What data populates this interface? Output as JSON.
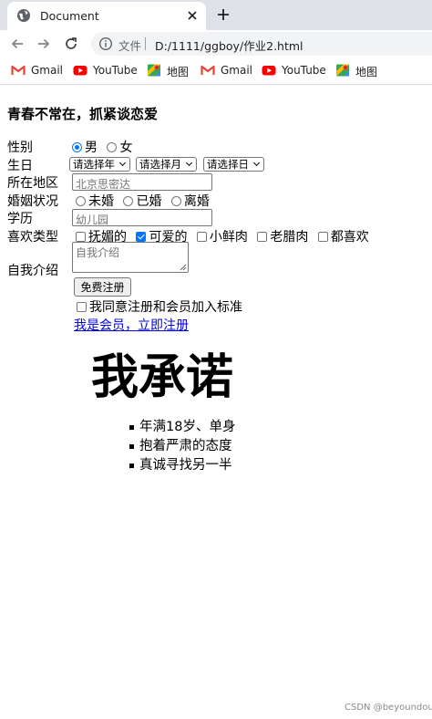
{
  "browser": {
    "tab_title": "Document",
    "address_scheme": "文件",
    "address_url": "D:/1111/ggboy/作业2.html"
  },
  "bookmarks": [
    {
      "label": "Gmail",
      "icon": "gmail-icon"
    },
    {
      "label": "YouTube",
      "icon": "youtube-icon"
    },
    {
      "label": "地图",
      "icon": "maps-icon"
    },
    {
      "label": "Gmail",
      "icon": "gmail-icon"
    },
    {
      "label": "YouTube",
      "icon": "youtube-icon"
    },
    {
      "label": "地图",
      "icon": "maps-icon"
    }
  ],
  "form": {
    "heading": "青春不常在，抓紧谈恋爱",
    "gender": {
      "label": "性别",
      "options": [
        "男",
        "女"
      ],
      "selected": "男"
    },
    "birthday": {
      "label": "生日",
      "year": "请选择年",
      "month": "请选择月",
      "day": "请选择日"
    },
    "region": {
      "label": "所在地区",
      "placeholder": "北京思密达"
    },
    "marital": {
      "label": "婚姻状况",
      "options": [
        "未婚",
        "已婚",
        "离婚"
      ]
    },
    "education": {
      "label": "学历",
      "placeholder": "幼儿园"
    },
    "likes": {
      "label": "喜欢类型",
      "options": [
        "抚媚的",
        "可爱的",
        "小鲜肉",
        "老腊肉",
        "都喜欢"
      ],
      "checked": [
        "可爱的"
      ]
    },
    "intro": {
      "label": "自我介绍",
      "placeholder": "自我介绍"
    },
    "submit_label": "免费注册",
    "agree_label": "我同意注册和会员加入标准",
    "member_link": "我是会员，立即注册"
  },
  "promise": {
    "title": "我承诺",
    "items": [
      "年满18岁、单身",
      "抱着严肃的态度",
      "真诚寻找另一半"
    ]
  },
  "watermark": "CSDN @beyoundout",
  "colors": {
    "accent": "#0075ff",
    "link": "#0000ee",
    "chrome": "#dee1e6"
  }
}
